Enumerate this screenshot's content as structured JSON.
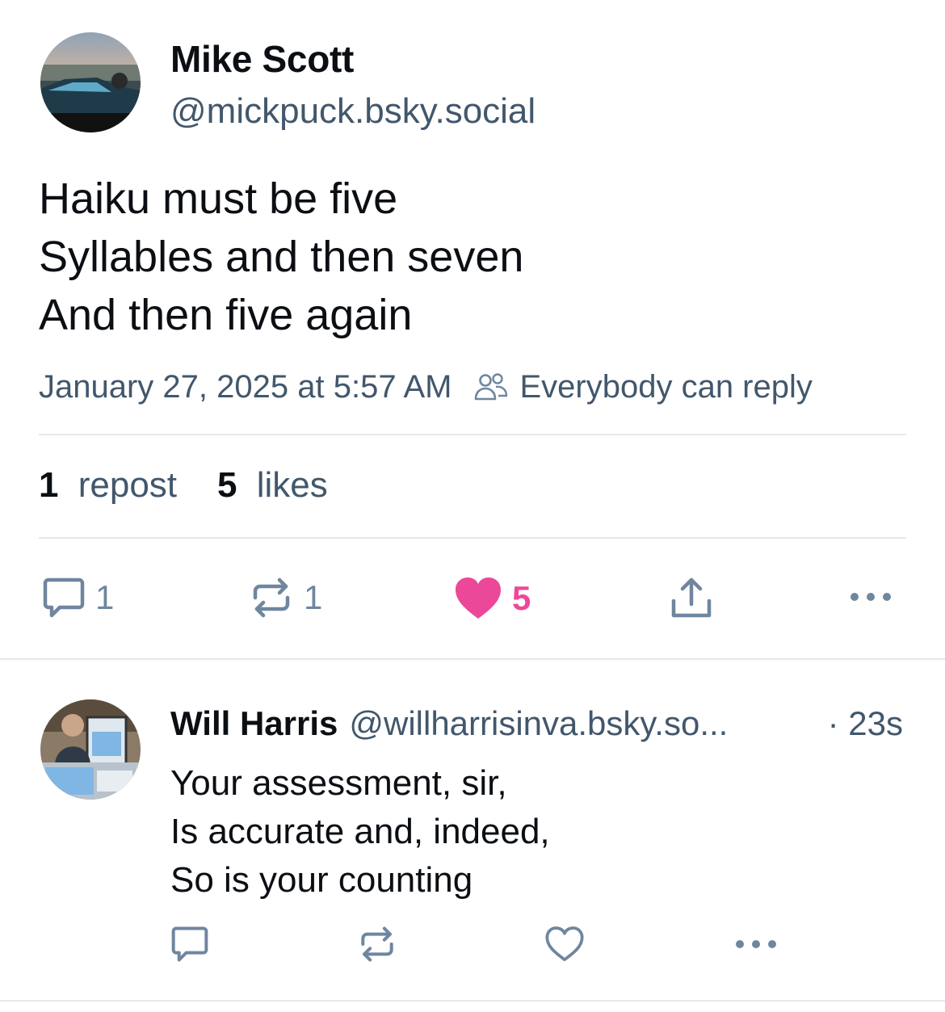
{
  "post": {
    "author": {
      "name": "Mike Scott",
      "handle": "@mickpuck.bsky.social",
      "avatar_icon": "car-landscape-avatar"
    },
    "text_lines": [
      "Haiku must be five",
      "Syllables and then seven",
      "And then five again"
    ],
    "timestamp": "January 27, 2025 at 5:57 AM",
    "reply_setting": "Everybody can reply",
    "stats": {
      "reposts_count": "1",
      "reposts_label": "repost",
      "likes_count": "5",
      "likes_label": "likes"
    },
    "actions": {
      "reply_count": "1",
      "repost_count": "1",
      "like_count": "5",
      "liked": true
    }
  },
  "reply": {
    "author": {
      "name": "Will Harris",
      "handle": "@willharrisinva.bsky.so...",
      "avatar_icon": "book-signing-avatar"
    },
    "time": "· 23s",
    "text_lines": [
      "Your assessment, sir,",
      "Is accurate and, indeed,",
      "So is your counting"
    ]
  },
  "colors": {
    "text_primary": "#0b0f14",
    "text_secondary": "#42576c",
    "icon": "#6f869f",
    "like_accent": "#ec4899",
    "divider": "#e4e8ec"
  }
}
